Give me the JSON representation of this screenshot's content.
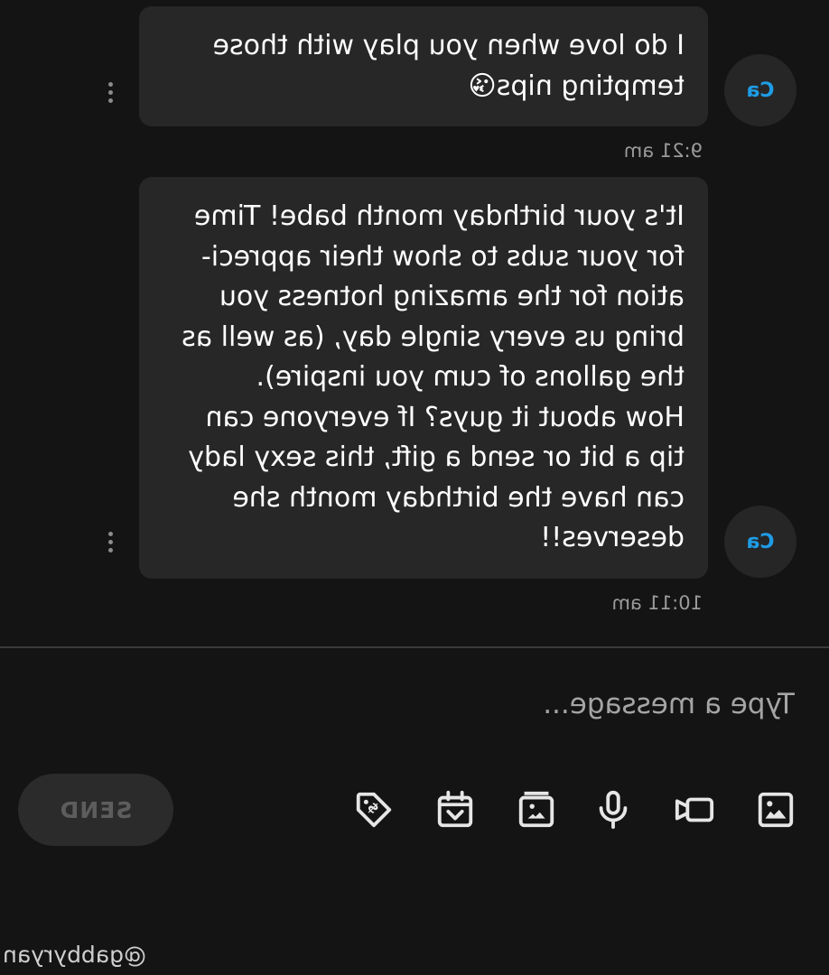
{
  "messages": [
    {
      "avatar_initials": "Ca",
      "text": "I do love when you play with those\ntempting nips😘",
      "time": "9:21 am"
    },
    {
      "avatar_initials": "Ca",
      "text": "It's your birthday month babe! Time\nfor your subs to show their appreci-\nation for the amazing hotness you\nbring us every single day, (as well as\nthe gallons of cum you inspire).\nHow about it guys? If everyone can\ntip a bit or send a gift, this sexy lady\ncan have the birthday month she\ndeserves!!",
      "time": "10:11 am"
    }
  ],
  "composer": {
    "placeholder": "Type a message...",
    "value": "",
    "tools": [
      "image-icon",
      "video-icon",
      "microphone-icon",
      "vault-icon",
      "calendar-icon",
      "price-tag-icon"
    ],
    "send_label": "SEND"
  },
  "watermark": "@gabbyryan",
  "colors": {
    "background": "#141414",
    "bubble": "#272727",
    "avatar_bg": "#262626",
    "avatar_text": "#1e9ce6",
    "timestamp": "#9a9a9a",
    "icon": "#e6e6e6",
    "send_bg": "#2b2b2b",
    "send_text": "#5d5d5d"
  }
}
